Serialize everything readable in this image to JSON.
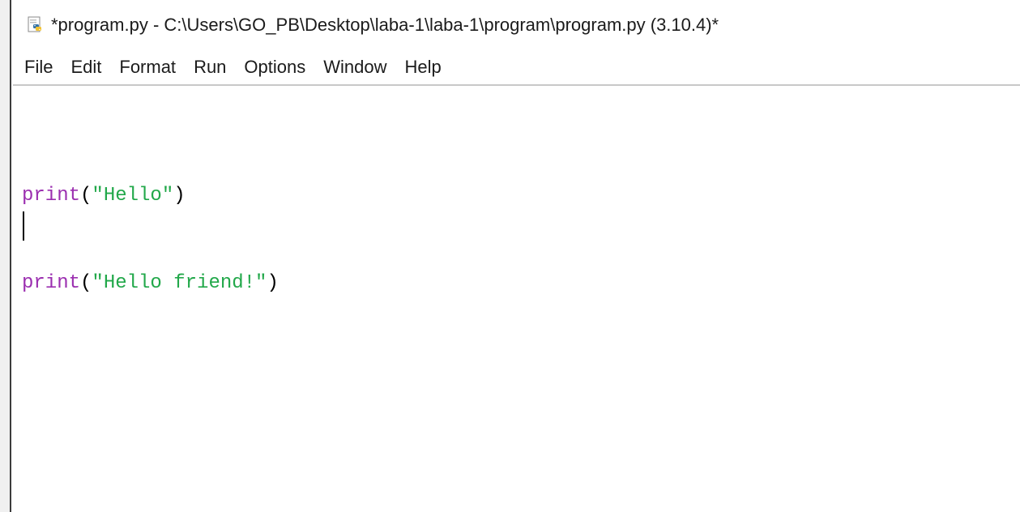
{
  "window": {
    "title": "*program.py - C:\\Users\\GO_PB\\Desktop\\laba-1\\laba-1\\program\\program.py (3.10.4)*",
    "icon": "python-file-icon"
  },
  "menu": {
    "items": [
      "File",
      "Edit",
      "Format",
      "Run",
      "Options",
      "Window",
      "Help"
    ]
  },
  "editor": {
    "lines": [
      {
        "func": "print",
        "open": "(",
        "string": "\"Hello\"",
        "close": ")"
      },
      {
        "func": "print",
        "open": "(",
        "string": "\"Hello friend!\"",
        "close": ")"
      }
    ]
  },
  "colors": {
    "keyword": "#9b2fb0",
    "string": "#22a84a",
    "text": "#000000"
  }
}
